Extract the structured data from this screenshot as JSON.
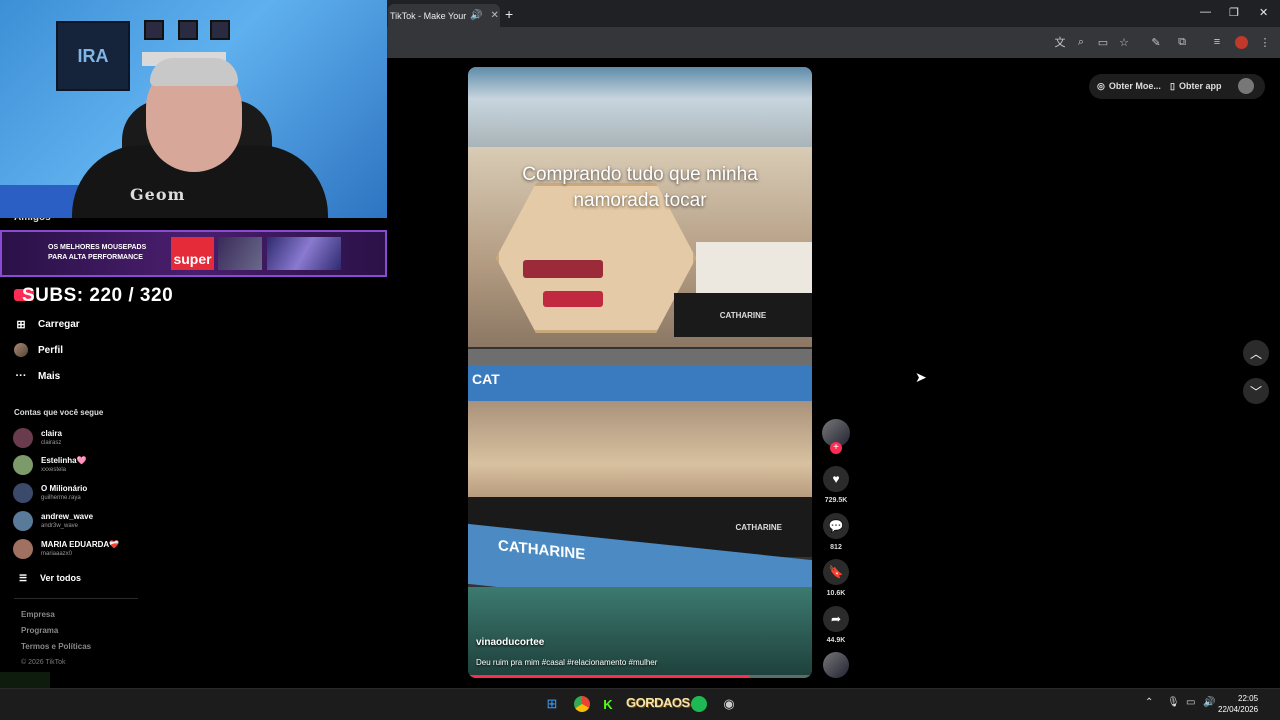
{
  "browser": {
    "tab_title": "TikTok - Make Your Da",
    "new_tab": "+",
    "window": {
      "minimize": "—",
      "restore": "❐",
      "close": "✕"
    }
  },
  "webcam": {
    "poster_text": "IRA",
    "shirt_text": "Geom"
  },
  "banner": {
    "line1": "OS MELHORES MOUSEPADS",
    "line2": "PARA ALTA PERFORMANCE",
    "brand": "super"
  },
  "subs": "SUBS: 220 / 320",
  "sidebar": {
    "amigos": "Amigos",
    "items": [
      {
        "label": "Carregar",
        "icon": "upload-icon"
      },
      {
        "label": "Perfil",
        "icon": "profile-avatar"
      },
      {
        "label": "Mais",
        "icon": "more-icon"
      }
    ],
    "following_header": "Contas que você segue",
    "accounts": [
      {
        "name": "claira",
        "user": "clairasz",
        "color": "#6a3b4d"
      },
      {
        "name": "Estelinha🩷",
        "user": "xxxestela",
        "color": "#7d9a6b"
      },
      {
        "name": "O Milionário",
        "user": "guilherme.raya",
        "color": "#3b4a6a"
      },
      {
        "name": "andrew_wave",
        "user": "andr3w_wave",
        "color": "#5a7a9a"
      },
      {
        "name": "MARIA EDUARDA❤️‍🩹",
        "user": "mariaaazx0",
        "color": "#a07060"
      }
    ],
    "see_all": "Ver todos",
    "footer": [
      "Empresa",
      "Programa",
      "Termos e Políticas"
    ],
    "copyright": "© 2026 TikTok"
  },
  "video": {
    "caption_line1": "Comprando tudo que minha",
    "caption_line2": "namorada tocar",
    "brand1": "CATHARINE",
    "brand2": "CATHARINE",
    "brand3": "CATHARINE",
    "band_text": "CAT",
    "handle": "vinaoducortee",
    "description": "Deu ruim pra mim #casal #relacionamento #mulher",
    "progress": 0.82
  },
  "actions": {
    "likes": "729.5K",
    "comments": "812",
    "saves": "10.6K",
    "shares": "44.9K"
  },
  "topbar": {
    "coins": "Obter Moe...",
    "app": "Obter app"
  },
  "taskbar": {
    "gordaos": "GORDAOS",
    "time": "22:05",
    "date": "22/04/2026"
  },
  "colors": {
    "accent": "#fe2c55",
    "background": "#000000"
  }
}
